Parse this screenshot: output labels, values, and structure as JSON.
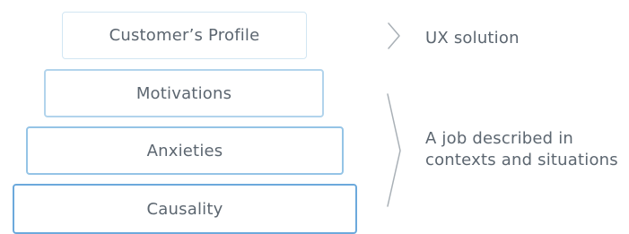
{
  "pyramid": {
    "levels": [
      {
        "label": "Customer’s Profile"
      },
      {
        "label": "Motivations"
      },
      {
        "label": "Anxieties"
      },
      {
        "label": "Causality"
      }
    ]
  },
  "annotations": {
    "top": {
      "text": "UX solution"
    },
    "bottom": {
      "lines": [
        "A job described in",
        "contexts and situations"
      ]
    }
  },
  "colors": {
    "text": "#5c6670",
    "bracket": "#a9b0b6",
    "level_borders": [
      "#d2e6f3",
      "#b2d4ec",
      "#95c4e6",
      "#6ca9dc"
    ]
  }
}
